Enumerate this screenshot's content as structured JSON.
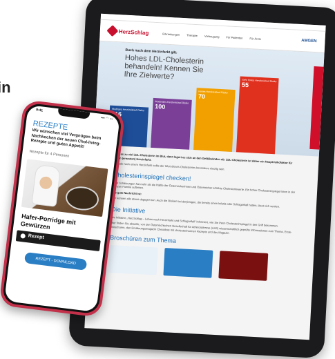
{
  "edge_text": "in",
  "tablet": {
    "top_strip": "",
    "logo": "HerzSchlag",
    "brand": "AMGEN",
    "nav": [
      "Erkrankungen",
      "Therapie",
      "Vorbeugung",
      "Für Patienten",
      "Für Ärzte"
    ],
    "hero": {
      "kicker": "Buch nach dem Herzinfarkt gilt:",
      "title": "Hohes LDL-Cholesterin behandeln! Kennen Sie Ihre Zielwerte?",
      "bars": [
        {
          "label": "Niedriges Herzkreislauf-Risiko",
          "value": "116",
          "color": "#1f4e99"
        },
        {
          "label": "Moderates Herzkreislauf-Risiko",
          "value": "100",
          "color": "#7b3f98"
        },
        {
          "label": "Hohes Herzkreislauf-Risiko",
          "value": "70",
          "color": "#f2a000"
        },
        {
          "label": "Sehr hohes Herzkreislauf-Risiko",
          "value": "55",
          "color": "#e0301e"
        }
      ]
    },
    "intro_bold": "Gibt es zu viel LDL-Cholesterin im Blut, dann lagert es sich an den Gefäßwänden ab. LDL-Cholesterin ist daher ein Hauptrisikofaktor für einen (erneuten) Herzinfarkt.",
    "intro": "Gerade nach einem Herzinfarkt sollte der Wert dieses Cholesterins besonders niedrig sein.",
    "section1_title": "Cholesterinspiegel checken!",
    "section1_text": "Laut Schätzungen hat mehr als die Hälfte der Österreicherinnen und Österreicher erhöhte Cholesterinwerte. Ein hoher Cholesterinspiegel kann in der ganzen Familie auftreten.",
    "section1_bold": "Die gute Nachricht ist:",
    "section1_text2": "Wir können alle etwas dagegen tun. Auch die Risiken bei denjenigen, die bereits einen Infarkt oder Schlaganfall hatten, lässt sich senken.",
    "section2_title": "Die Initiative",
    "section2_text": "Die Initiative „HerzSchlag – Leben nach Herzinfarkt und Schlaganfall“ informiert, wie Sie Ihren Cholesterinspiegel in den Griff bekommen.",
    "section2_text2": "Hier finden Sie aktuelle, von der Österreichischen Gesellschaft für Atherosklerose (AAS) wissenschaftlich geprüfte Informationen zum Thema, Erste-Broschüren, den Ernährungsmagazin Checkliste mit cholesterinarmen Rezepte und das Magazin.",
    "section3_title": "Broschüren zum Thema"
  },
  "phone": {
    "time": "9:41",
    "signal": "▪▪▪ ◠ ▭",
    "section": "REZEPTE",
    "subtitle": "Wir wünschen viel Vergnügen beim Nachkochen der neuen Chol-living-Rezepte und guten Appetit!",
    "note": "Rezepte für 4 Personen",
    "dish": "Hafer-Porridge mit Gewürzen",
    "badge": "Rezept",
    "download": "REZEPT - DOWNLOAD"
  }
}
